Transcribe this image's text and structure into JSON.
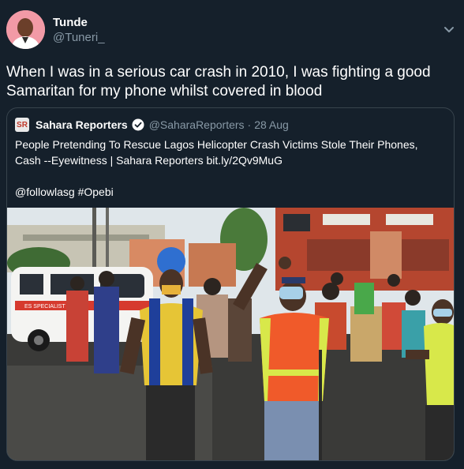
{
  "author": {
    "name": "Tunde",
    "handle": "@Tuneri_",
    "avatar_icon": "profile-photo"
  },
  "menu_icon": "chevron-down-icon",
  "tweet": {
    "text": "When I was in a serious car crash in 2010, I was  fighting a good Samaritan for my phone whilst covered in blood"
  },
  "quoted": {
    "logo_text": "SR",
    "name": "Sahara Reporters",
    "verified_icon": "verified-badge-icon",
    "handle": "@SaharaReporters",
    "separator": "·",
    "date": "28 Aug",
    "text": "People Pretending To Rescue Lagos Helicopter Crash Victims Stole Their Phones, Cash --Eyewitness | Sahara Reporters bit.ly/2Qv9MuG",
    "tags": "@followlasg #Opebi",
    "photo": {
      "ambulance_label": "ES SPECIALIST HOSPI",
      "colors": {
        "sky": "#dfe6ea",
        "brick": "#b5462f",
        "ground": "#3a3a38",
        "vest_orange": "#f05a2a",
        "vest_yellow": "#d8e84a"
      }
    }
  },
  "colors": {
    "background": "#15202b",
    "secondary_text": "#8899a6",
    "border": "#38444d",
    "verified": "#ffffff"
  }
}
